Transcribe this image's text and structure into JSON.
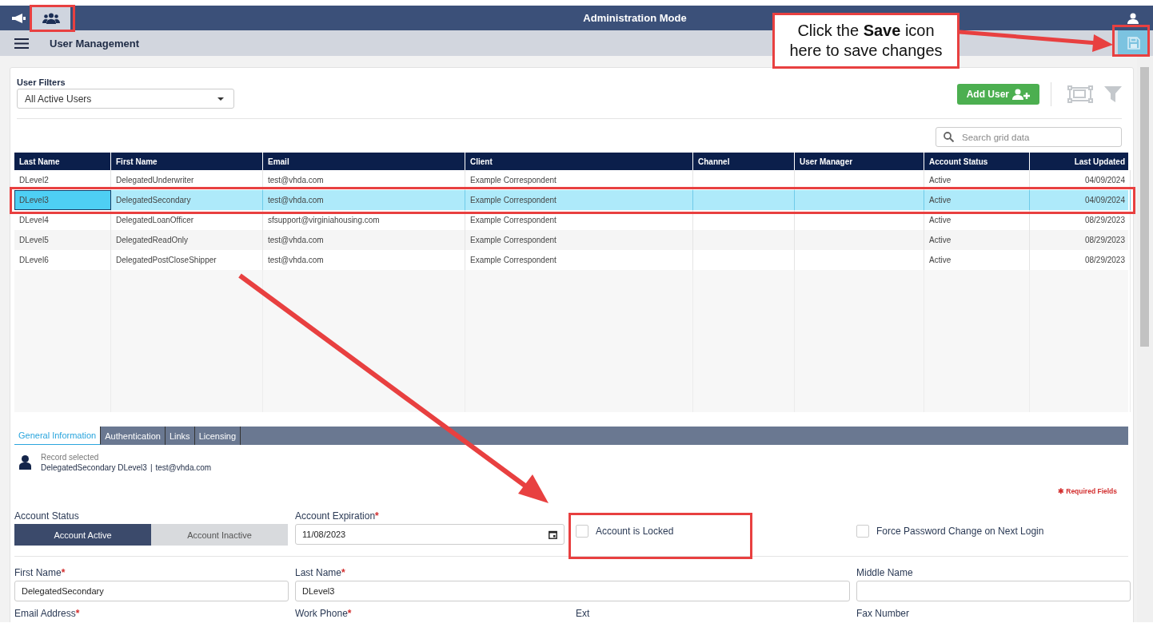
{
  "top_bar": {
    "tabs": [
      {
        "kind": "megaphone",
        "selected": false
      },
      {
        "kind": "people",
        "selected": true
      }
    ],
    "title": "Administration Mode"
  },
  "header": {
    "title": "User Management"
  },
  "filters": {
    "label": "User Filters",
    "value": "All Active Users"
  },
  "add_user": "Add User",
  "search": {
    "placeholder": "Search grid data"
  },
  "table": {
    "columns": [
      "Last Name",
      "First Name",
      "Email",
      "Client",
      "Channel",
      "User Manager",
      "Account Status",
      "Last Updated"
    ],
    "rows": [
      {
        "selected": false,
        "cells": [
          "DLevel2",
          "DelegatedUnderwriter",
          "test@vhda.com",
          "Example Correspondent",
          "",
          "",
          "Active",
          "04/09/2024"
        ]
      },
      {
        "selected": true,
        "cells": [
          "DLevel3",
          "DelegatedSecondary",
          "test@vhda.com",
          "Example Correspondent",
          "",
          "",
          "Active",
          "04/09/2024"
        ]
      },
      {
        "selected": false,
        "cells": [
          "DLevel4",
          "DelegatedLoanOfficer",
          "sfsupport@virginiahousing.com",
          "Example Correspondent",
          "",
          "",
          "Active",
          "08/29/2023"
        ]
      },
      {
        "selected": false,
        "cells": [
          "DLevel5",
          "DelegatedReadOnly",
          "test@vhda.com",
          "Example Correspondent",
          "",
          "",
          "Active",
          "08/29/2023"
        ]
      },
      {
        "selected": false,
        "cells": [
          "DLevel6",
          "DelegatedPostCloseShipper",
          "test@vhda.com",
          "Example Correspondent",
          "",
          "",
          "Active",
          "08/29/2023"
        ]
      }
    ]
  },
  "detail_tabs": [
    {
      "label": "General Information",
      "selected": true
    },
    {
      "label": "Authentication",
      "selected": false
    },
    {
      "label": "Links",
      "selected": false
    },
    {
      "label": "Licensing",
      "selected": false
    }
  ],
  "record": {
    "caption": "Record selected",
    "name": "DelegatedSecondary DLevel3",
    "separator": "|",
    "email": "test@vhda.com"
  },
  "required_note": {
    "mark": "✱",
    "text": "Required Fields"
  },
  "account_status": {
    "label": "Account Status",
    "options": [
      {
        "label": "Account Active",
        "selected": true
      },
      {
        "label": "Account Inactive",
        "selected": false
      }
    ]
  },
  "account_expiration": {
    "label": "Account Expiration",
    "required": true,
    "value": "11/08/2023"
  },
  "checkboxes": [
    {
      "label": "Account is Locked",
      "checked": false
    },
    {
      "label": "Force Password Change on Next Login",
      "checked": false
    }
  ],
  "name_fields": [
    {
      "label": "First Name",
      "required": true,
      "value": "DelegatedSecondary"
    },
    {
      "label": "Last Name",
      "required": true,
      "value": "DLevel3"
    },
    {
      "label": "Middle Name",
      "required": false
    }
  ],
  "contact_fields": [
    {
      "label": "Email Address",
      "required": true
    },
    {
      "label": "Work Phone",
      "required": true
    },
    {
      "label": "Ext",
      "required": false
    },
    {
      "label": "Fax Number",
      "required": false
    }
  ],
  "required_mark": "*",
  "annotation": {
    "callout": "Click the **Save** icon here to save changes"
  }
}
